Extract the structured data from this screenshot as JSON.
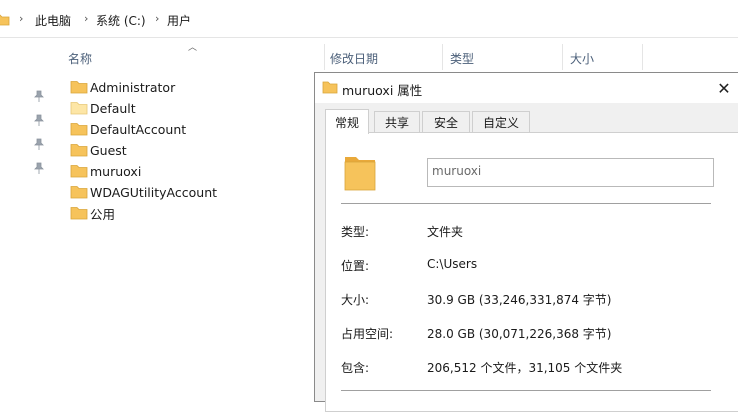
{
  "address_bar": {
    "crumbs": [
      "此电脑",
      "系统 (C:)",
      "用户"
    ]
  },
  "columns": {
    "name": "名称",
    "modified": "修改日期",
    "type": "类型",
    "size": "大小"
  },
  "files": [
    {
      "name": "Administrator",
      "icon": "folder-icon"
    },
    {
      "name": "Default",
      "icon": "folder-light-icon"
    },
    {
      "name": "DefaultAccount",
      "icon": "folder-icon"
    },
    {
      "name": "Guest",
      "icon": "folder-icon"
    },
    {
      "name": "muruoxi",
      "icon": "folder-icon"
    },
    {
      "name": "WDAGUtilityAccount",
      "icon": "folder-icon"
    },
    {
      "name": "公用",
      "icon": "folder-icon"
    }
  ],
  "dialog": {
    "title": "muruoxi 属性",
    "close_glyph": "✕",
    "tabs": [
      "常规",
      "共享",
      "安全",
      "自定义"
    ],
    "active_tab": "常规",
    "name_value": "muruoxi",
    "properties": [
      {
        "label": "类型:",
        "value": "文件夹"
      },
      {
        "label": "位置:",
        "value": "C:\\Users"
      },
      {
        "label": "大小:",
        "value": "30.9 GB (33,246,331,874 字节)"
      },
      {
        "label": "占用空间:",
        "value": "28.0 GB (30,071,226,368 字节)"
      },
      {
        "label": "包含:",
        "value": "206,512 个文件，31,105 个文件夹"
      }
    ]
  },
  "colors": {
    "folder": "#f6c35b",
    "folder_light": "#fde6a6",
    "header_text": "#4c607a"
  }
}
